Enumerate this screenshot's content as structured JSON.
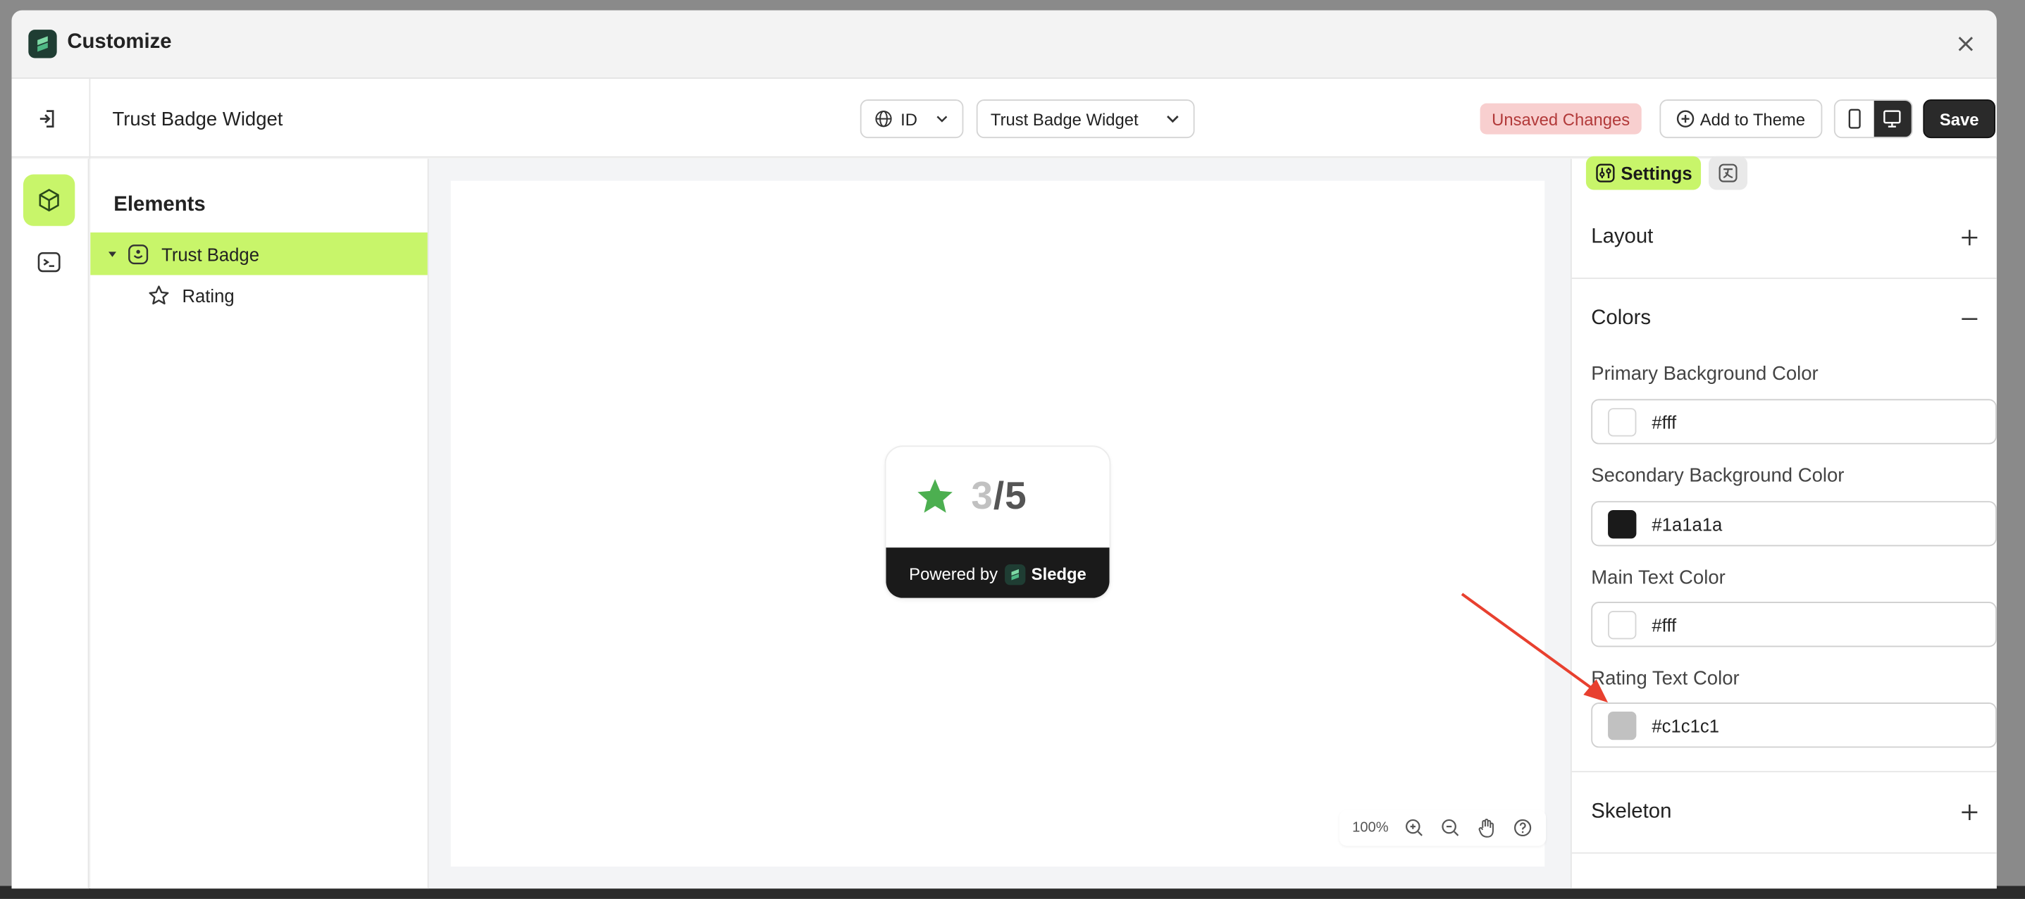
{
  "window": {
    "title": "Customize"
  },
  "toolbar": {
    "page_title": "Trust Badge Widget",
    "language": "ID",
    "widget_select": "Trust Badge Widget",
    "unsaved": "Unsaved Changes",
    "add_to_theme": "Add to Theme",
    "save": "Save"
  },
  "elements": {
    "title": "Elements",
    "items": [
      {
        "label": "Trust Badge"
      },
      {
        "label": "Rating"
      }
    ]
  },
  "preview": {
    "rating_value": "3",
    "rating_sep": "/5",
    "powered_by": "Powered by",
    "brand": "Sledge",
    "zoom": "100%"
  },
  "settings": {
    "tab_settings": "Settings",
    "sections": {
      "layout": "Layout",
      "colors": "Colors",
      "skeleton": "Skeleton"
    },
    "fields": [
      {
        "label": "Primary Background Color",
        "value": "#fff",
        "swatch": "#ffffff"
      },
      {
        "label": "Secondary Background Color",
        "value": "#1a1a1a",
        "swatch": "#1a1a1a"
      },
      {
        "label": "Main Text Color",
        "value": "#fff",
        "swatch": "#ffffff"
      },
      {
        "label": "Rating Text Color",
        "value": "#c1c1c1",
        "swatch": "#c1c1c1"
      }
    ]
  },
  "colors": {
    "accent": "#c8f56a",
    "star": "#4caf50",
    "rating_number": "#c1c1c1",
    "annotation_arrow": "#e8402f"
  }
}
